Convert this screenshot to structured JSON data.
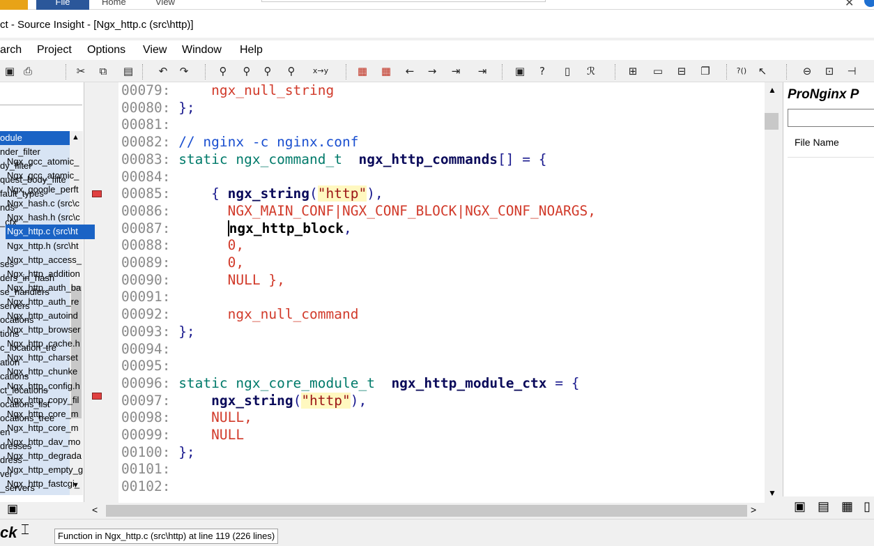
{
  "ribbon": {
    "file": "File",
    "home": "Home",
    "view": "View"
  },
  "window": {
    "title": "ct - Source Insight - [Ngx_http.c (src\\http)]"
  },
  "menu": [
    "arch",
    "Project",
    "Options",
    "View",
    "Window",
    "Help"
  ],
  "symbols": {
    "items": [
      "odule",
      "nder_filter",
      "dy_filter",
      "quest_body_filte",
      "fault_types",
      "nds",
      "_ctx",
      "",
      "",
      "ses",
      "ders_in_hash",
      "se_handlers",
      "servers",
      "ocations",
      "tions",
      "c_location_tre",
      "ation",
      "cations",
      "ct_locations",
      "ocations_list",
      "ocations_tree",
      "en",
      "dresses",
      "dress",
      "ver",
      "_servers"
    ],
    "selected_index": 0
  },
  "editor": {
    "lines": [
      {
        "n": "00079:",
        "code": [
          {
            "t": "    ",
            "c": ""
          },
          {
            "t": "ngx_null_string",
            "c": "mac"
          }
        ]
      },
      {
        "n": "00080:",
        "code": [
          {
            "t": "};",
            "c": "kw"
          }
        ]
      },
      {
        "n": "00081:",
        "code": []
      },
      {
        "n": "00082:",
        "code": [
          {
            "t": "// nginx -c nginx.conf",
            "c": "cmt"
          }
        ]
      },
      {
        "n": "00083:",
        "code": [
          {
            "t": "static ngx_command_t  ",
            "c": "ty"
          },
          {
            "t": "ngx_http_commands",
            "c": "fn"
          },
          {
            "t": "[] = {",
            "c": "kw"
          }
        ]
      },
      {
        "n": "00084:",
        "code": []
      },
      {
        "n": "00085:",
        "code": [
          {
            "t": "    { ",
            "c": "kw"
          },
          {
            "t": "ngx_string",
            "c": "fn"
          },
          {
            "t": "(",
            "c": "kw"
          },
          {
            "t": "\"http\"",
            "c": "str"
          },
          {
            "t": "),",
            "c": "kw"
          }
        ]
      },
      {
        "n": "00086:",
        "code": [
          {
            "t": "      ",
            "c": ""
          },
          {
            "t": "NGX_MAIN_CONF|NGX_CONF_BLOCK|NGX_CONF_NOARGS,",
            "c": "mac"
          }
        ]
      },
      {
        "n": "00087:",
        "code": [
          {
            "t": "      ",
            "c": ""
          },
          {
            "t": "ngx_http_block",
            "c": "bf cur"
          },
          {
            "t": ",",
            "c": "kw"
          }
        ]
      },
      {
        "n": "00088:",
        "code": [
          {
            "t": "      ",
            "c": ""
          },
          {
            "t": "0,",
            "c": "mac"
          }
        ]
      },
      {
        "n": "00089:",
        "code": [
          {
            "t": "      ",
            "c": ""
          },
          {
            "t": "0,",
            "c": "mac"
          }
        ]
      },
      {
        "n": "00090:",
        "code": [
          {
            "t": "      ",
            "c": ""
          },
          {
            "t": "NULL },",
            "c": "mac"
          }
        ]
      },
      {
        "n": "00091:",
        "code": []
      },
      {
        "n": "00092:",
        "code": [
          {
            "t": "      ",
            "c": ""
          },
          {
            "t": "ngx_null_command",
            "c": "mac"
          }
        ]
      },
      {
        "n": "00093:",
        "code": [
          {
            "t": "};",
            "c": "kw"
          }
        ]
      },
      {
        "n": "00094:",
        "code": []
      },
      {
        "n": "00095:",
        "code": []
      },
      {
        "n": "00096:",
        "code": [
          {
            "t": "static ngx_core_module_t  ",
            "c": "ty"
          },
          {
            "t": "ngx_http_module_ctx",
            "c": "fn"
          },
          {
            "t": " = {",
            "c": "kw"
          }
        ]
      },
      {
        "n": "00097:",
        "code": [
          {
            "t": "    ",
            "c": ""
          },
          {
            "t": "ngx_string",
            "c": "fn"
          },
          {
            "t": "(",
            "c": "kw"
          },
          {
            "t": "\"http\"",
            "c": "str"
          },
          {
            "t": "),",
            "c": "kw"
          }
        ]
      },
      {
        "n": "00098:",
        "code": [
          {
            "t": "    ",
            "c": ""
          },
          {
            "t": "NULL,",
            "c": "mac"
          }
        ]
      },
      {
        "n": "00099:",
        "code": [
          {
            "t": "    ",
            "c": ""
          },
          {
            "t": "NULL",
            "c": "mac"
          }
        ]
      },
      {
        "n": "00100:",
        "code": [
          {
            "t": "};",
            "c": "kw"
          }
        ]
      },
      {
        "n": "00101:",
        "code": []
      },
      {
        "n": "00102:",
        "code": []
      }
    ],
    "bookmark_lines": [
      "00085:",
      "00097:"
    ]
  },
  "project": {
    "title": "ProNginx P",
    "search_value": "",
    "column_header": "File Name",
    "files": [
      "Ngx_gcc_atomic_",
      "Ngx_gcc_atomic_",
      "Ngx_google_perft",
      "Ngx_hash.c (src\\c",
      "Ngx_hash.h (src\\c",
      "Ngx_http.c (src\\ht",
      "Ngx_http.h (src\\ht",
      "Ngx_http_access_",
      "Ngx_http_addition",
      "Ngx_http_auth_ba",
      "Ngx_http_auth_re",
      "Ngx_http_autoind",
      "Ngx_http_browser",
      "Ngx_http_cache.h",
      "Ngx_http_charset",
      "Ngx_http_chunke",
      "Ngx_http_config.h",
      "Ngx_http_copy_fil",
      "Ngx_http_core_m",
      "Ngx_http_core_m",
      "Ngx_http_dav_mo",
      "Ngx_http_degrada",
      "Ngx_http_empty_g",
      "Ngx_http_fastcgi_"
    ],
    "selected_index": 5
  },
  "status": {
    "label": "ck",
    "text": "Function in Ngx_http.c (src\\http) at line 119 (226 lines)"
  },
  "icons": [
    "save-icon",
    "print-icon",
    "cut-icon",
    "copy-icon",
    "paste-icon",
    "undo-icon",
    "redo-icon",
    "search-icon",
    "search-files-icon",
    "lookup-icon",
    "replace-icon",
    "bookmark-icon",
    "prev-icon",
    "next-icon",
    "back-icon",
    "forward-icon",
    "indent-icon",
    "outdent-icon",
    "project-icon",
    "symbol-icon",
    "browse-icon",
    "relation-icon",
    "layout-icon",
    "window-icon",
    "context-icon",
    "help-pointer-icon"
  ]
}
